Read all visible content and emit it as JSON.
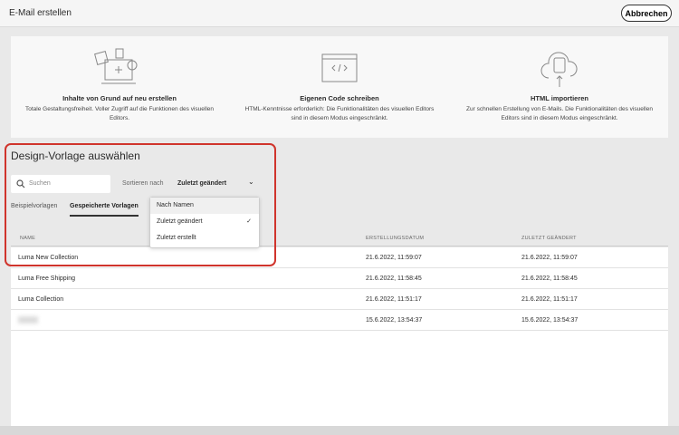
{
  "header": {
    "title": "E-Mail erstellen",
    "cancel": "Abbrechen"
  },
  "cards": [
    {
      "title": "Inhalte von Grund auf neu erstellen",
      "desc": "Totale Gestaltungsfreiheit. Voller Zugriff auf die Funktionen des visuellen Editors."
    },
    {
      "title": "Eigenen Code schreiben",
      "desc": "HTML-Kenntnisse erforderlich: Die Funktionalitäten des visuellen Editors sind in diesem Modus eingeschränkt."
    },
    {
      "title": "HTML importieren",
      "desc": "Zur schnellen Erstellung von E-Mails. Die Funktionalitäten des visuellen Editors sind in diesem Modus eingeschränkt."
    }
  ],
  "section": {
    "title": "Design-Vorlage auswählen",
    "search_placeholder": "Suchen",
    "sort_label": "Sortieren nach",
    "sort_value": "Zuletzt geändert"
  },
  "tabs": [
    "Beispielvorlagen",
    "Gespeicherte Vorlagen"
  ],
  "dropdown": {
    "options": [
      "Nach Namen",
      "Zuletzt geändert",
      "Zuletzt erstellt"
    ],
    "selected": "Zuletzt geändert"
  },
  "table": {
    "headers": [
      "NAME",
      "ERSTELLUNGSDATUM",
      "ZULETZT GEÄNDERT"
    ],
    "rows": [
      {
        "name": "Luma New Collection",
        "created": "21.6.2022, 11:59:07",
        "modified": "21.6.2022, 11:59:07"
      },
      {
        "name": "Luma Free Shipping",
        "created": "21.6.2022, 11:58:45",
        "modified": "21.6.2022, 11:58:45"
      },
      {
        "name": "Luma Collection",
        "created": "21.6.2022, 11:51:17",
        "modified": "21.6.2022, 11:51:17"
      },
      {
        "name": "",
        "created": "15.6.2022, 13:54:37",
        "modified": "15.6.2022, 13:54:37"
      }
    ]
  }
}
